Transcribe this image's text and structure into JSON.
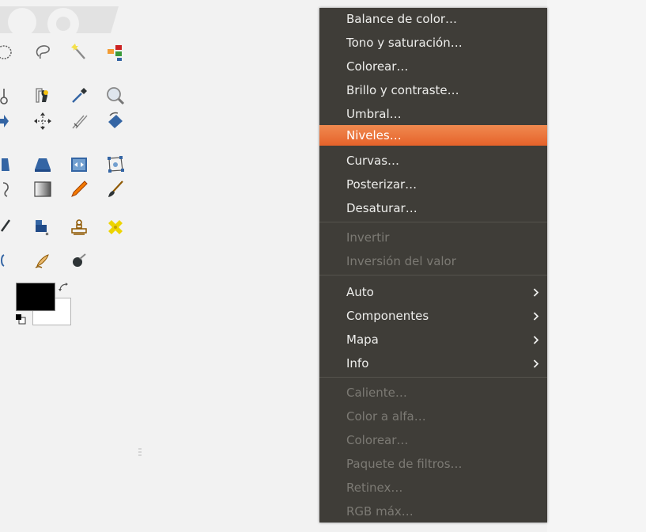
{
  "toolbox": {
    "tools": [
      "free-select-icon",
      "lasso-select-icon",
      "fuzzy-select-icon",
      "select-by-color-icon",
      "scissors-select-icon",
      "foreground-select-icon",
      "paths-icon",
      "color-picker-icon",
      "zoom-icon",
      "align-icon",
      "move-icon",
      "crop-icon",
      "rotate-icon",
      "shear-icon",
      "perspective-icon",
      "flip-icon",
      "cage-transform-icon",
      "text-icon",
      "bucket-fill-icon",
      "blend-icon",
      "pencil-icon",
      "paintbrush-icon",
      "eraser-icon",
      "airbrush-icon",
      "clone-icon",
      "heal-icon",
      "dodge-burn-icon",
      "smudge-icon",
      "ink-icon"
    ],
    "foreground_color": "#000000",
    "background_color": "#ffffff"
  },
  "menu": {
    "background_color": "#3f3d38",
    "highlight_color": "#e9703a",
    "items": [
      {
        "label": "Balance de color…",
        "enabled": true
      },
      {
        "label": "Tono y saturación…",
        "enabled": true
      },
      {
        "label": "Colorear…",
        "enabled": true
      },
      {
        "label": "Brillo y contraste…",
        "enabled": true
      },
      {
        "label": "Umbral…",
        "enabled": true
      },
      {
        "label": "Niveles…",
        "enabled": true,
        "highlighted": true
      },
      {
        "label": "Curvas…",
        "enabled": true
      },
      {
        "label": "Posterizar…",
        "enabled": true
      },
      {
        "label": "Desaturar…",
        "enabled": true
      },
      {
        "label": "Invertir",
        "enabled": false
      },
      {
        "label": "Inversión del valor",
        "enabled": false
      },
      {
        "label": "Auto",
        "enabled": true,
        "submenu": true
      },
      {
        "label": "Componentes",
        "enabled": true,
        "submenu": true
      },
      {
        "label": "Mapa",
        "enabled": true,
        "submenu": true
      },
      {
        "label": "Info",
        "enabled": true,
        "submenu": true
      },
      {
        "label": "Caliente…",
        "enabled": false
      },
      {
        "label": "Color a alfa…",
        "enabled": false
      },
      {
        "label": "Colorear…",
        "enabled": false
      },
      {
        "label": "Paquete de filtros…",
        "enabled": false
      },
      {
        "label": "Retinex…",
        "enabled": false
      },
      {
        "label": "RGB máx…",
        "enabled": false
      }
    ]
  }
}
